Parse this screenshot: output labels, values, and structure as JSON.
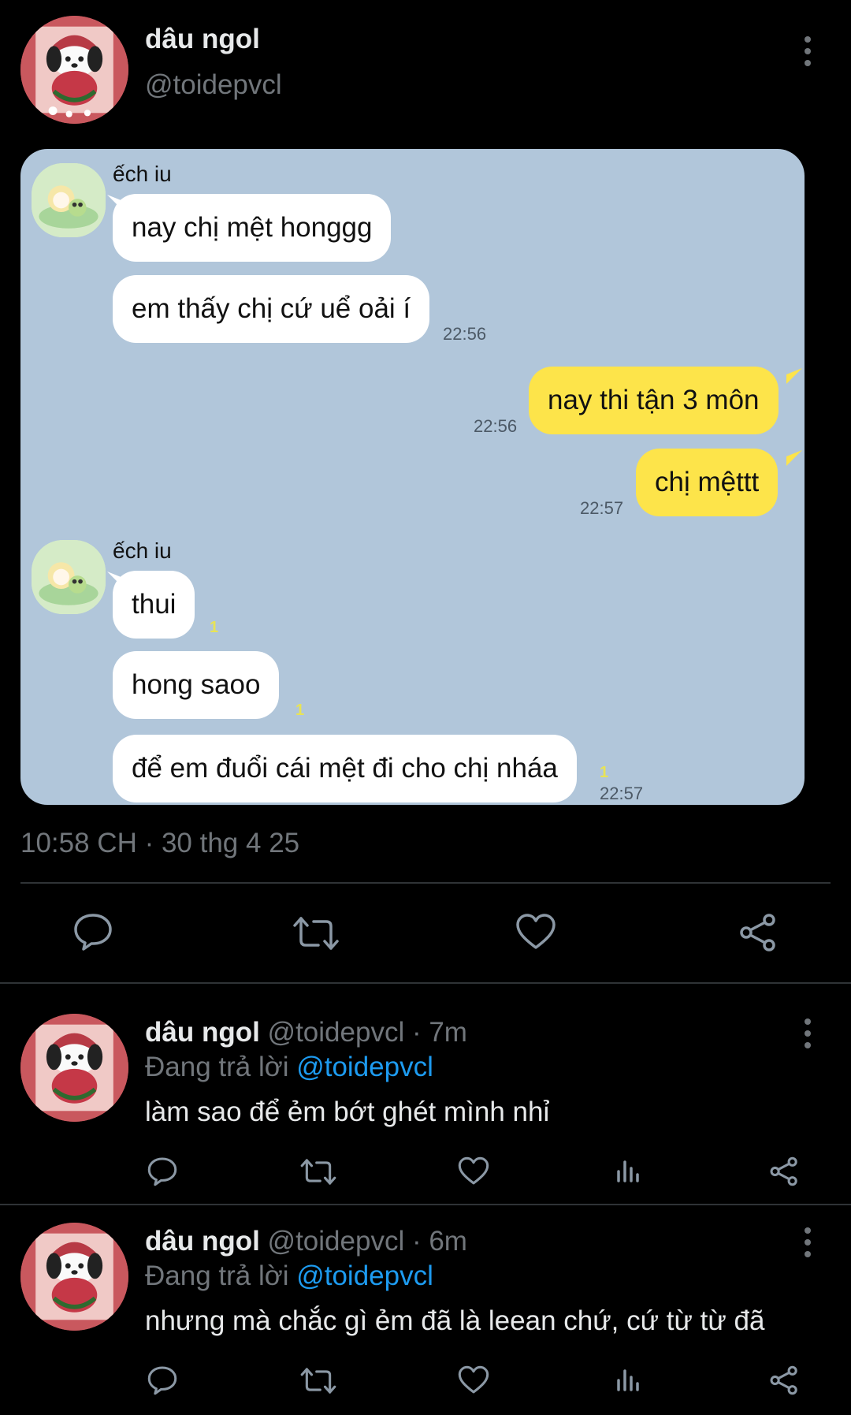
{
  "post": {
    "display_name": "dâu ngol",
    "handle": "@toidepvcl",
    "timestamp": "10:58 CH · 30 thg 4 25"
  },
  "chat": {
    "messages": [
      {
        "sender": "ếch iu",
        "text": "nay chị mệt honggg"
      },
      {
        "text": "em thấy chị cứ uể oải í",
        "time": "22:56"
      },
      {
        "text": "nay thi tận 3 môn",
        "time": "22:56"
      },
      {
        "text": "chị mệttt",
        "time": "22:57"
      },
      {
        "sender": "ếch iu",
        "text": "thui",
        "unread": "1"
      },
      {
        "text": "hong saoo",
        "unread": "1"
      },
      {
        "text": "để em đuổi cái mệt đi cho chị nháa",
        "unread": "1",
        "time": "22:57"
      }
    ]
  },
  "actions": {
    "icons": [
      "reply-icon",
      "retweet-icon",
      "like-icon",
      "share-icon"
    ]
  },
  "replies": [
    {
      "display_name": "dâu ngol",
      "meta": "@toidepvcl · 7m",
      "replying_label": "Đang trả lời",
      "mention": "@toidepvcl",
      "text": "làm sao để ẻm bớt ghét mình nhỉ"
    },
    {
      "display_name": "dâu ngol",
      "meta": "@toidepvcl · 6m",
      "replying_label": "Đang trả lời",
      "mention": "@toidepvcl",
      "text": "nhưng mà chắc gì ẻm đã là leean chứ, cứ từ từ đã"
    }
  ],
  "colors": {
    "background": "#000000",
    "chat_bg": "#b1c6da",
    "outgoing_bubble": "#fde44a",
    "incoming_bubble": "#ffffff",
    "mention": "#1d9bf0",
    "muted": "#71767b"
  }
}
